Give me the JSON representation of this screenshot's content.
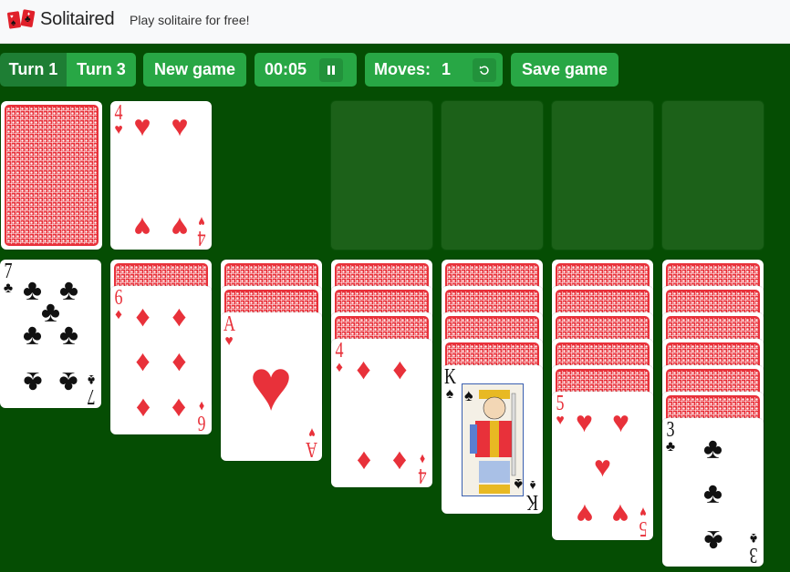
{
  "header": {
    "brand": "Solitaired",
    "tagline": "Play solitaire for free!",
    "logo_icon": "two-cards-logo-icon"
  },
  "toolbar": {
    "turn1_label": "Turn 1",
    "turn3_label": "Turn 3",
    "turn_mode_selected": "Turn 1",
    "new_game_label": "New game",
    "timer_value": "00:05",
    "pause_icon": "pause-icon",
    "moves_label": "Moves:",
    "moves_value": "1",
    "undo_icon": "undo-icon",
    "save_game_label": "Save game"
  },
  "colors": {
    "table": "#054d03",
    "button": "#28a745",
    "button_active": "#1e7e34",
    "foundation_slot": "#1c6119",
    "red_suit": "#e8313a",
    "black_suit": "#111111"
  },
  "stock": {
    "face_down": true
  },
  "waste": {
    "rank": "4",
    "suit": "♥",
    "color": "red"
  },
  "foundations": [
    {
      "empty": true
    },
    {
      "empty": true
    },
    {
      "empty": true
    },
    {
      "empty": true
    }
  ],
  "tableau": [
    {
      "face_down_count": 0,
      "top": {
        "rank": "7",
        "suit": "♣",
        "color": "black"
      }
    },
    {
      "face_down_count": 1,
      "top": {
        "rank": "6",
        "suit": "♦",
        "color": "red"
      }
    },
    {
      "face_down_count": 2,
      "top": {
        "rank": "A",
        "suit": "♥",
        "color": "red"
      }
    },
    {
      "face_down_count": 3,
      "top": {
        "rank": "4",
        "suit": "♦",
        "color": "red"
      }
    },
    {
      "face_down_count": 4,
      "top": {
        "rank": "K",
        "suit": "♠",
        "color": "black"
      }
    },
    {
      "face_down_count": 5,
      "top": {
        "rank": "5",
        "suit": "♥",
        "color": "red"
      }
    },
    {
      "face_down_count": 6,
      "top": {
        "rank": "3",
        "suit": "♣",
        "color": "black"
      }
    }
  ]
}
